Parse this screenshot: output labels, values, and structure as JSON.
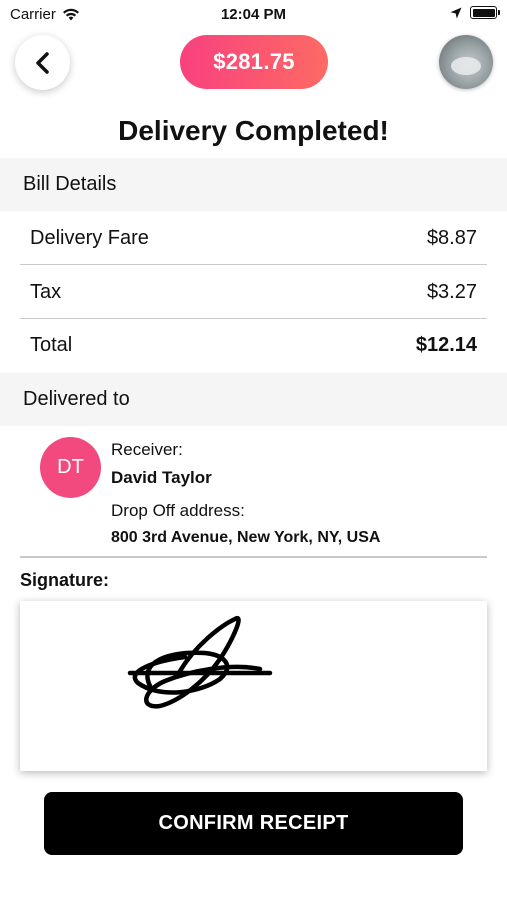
{
  "status_bar": {
    "carrier": "Carrier",
    "time": "12:04 PM",
    "icons": [
      "wifi-icon",
      "location-arrow-icon",
      "battery-icon"
    ]
  },
  "header": {
    "back_icon": "chevron-left-icon",
    "amount": "$281.75",
    "accent_gradient": [
      "#f8417f",
      "#fd6a63"
    ],
    "avatar": "profile-photo"
  },
  "title": "Delivery Completed!",
  "bill": {
    "section_title": "Bill Details",
    "rows": [
      {
        "label": "Delivery Fare",
        "value": "$8.87"
      },
      {
        "label": "Tax",
        "value": "$3.27"
      },
      {
        "label": "Total",
        "value": "$12.14"
      }
    ]
  },
  "delivered": {
    "section_title": "Delivered to",
    "initials": "DT",
    "avatar_color": "#f2497e",
    "receiver_label": "Receiver:",
    "receiver_name": "David Taylor",
    "address_label": "Drop Off address:",
    "address": "800 3rd Avenue, New York, NY, USA"
  },
  "signature": {
    "label": "Signature:"
  },
  "confirm_label": "CONFIRM RECEIPT"
}
